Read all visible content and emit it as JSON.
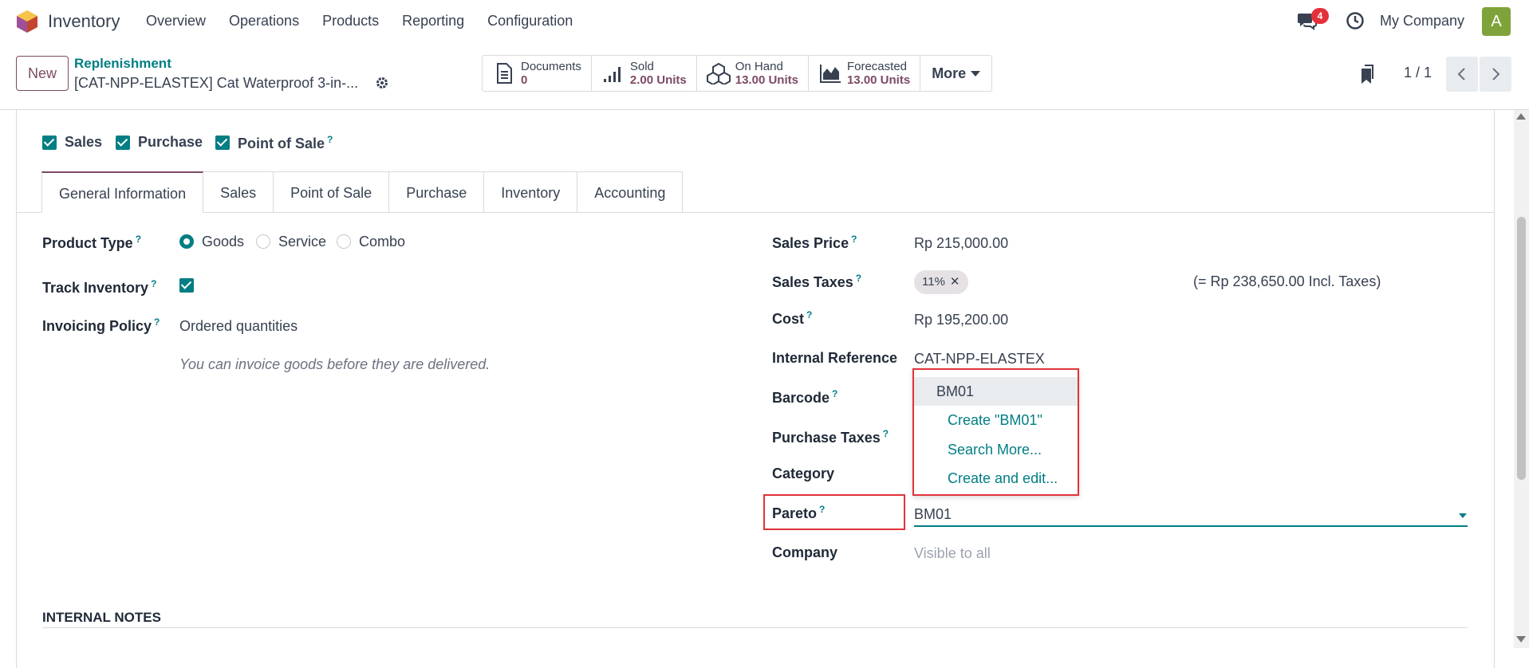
{
  "app": {
    "name": "Inventory"
  },
  "menu": [
    "Overview",
    "Operations",
    "Products",
    "Reporting",
    "Configuration"
  ],
  "systray": {
    "chat_count": "4",
    "company": "My Company",
    "avatar_letter": "A"
  },
  "control": {
    "new_label": "New",
    "breadcrumb_parent": "Replenishment",
    "breadcrumb_current": "[CAT-NPP-ELASTEX] Cat Waterproof 3-in-...",
    "pager": "1 / 1"
  },
  "smart_buttons": {
    "documents": {
      "label": "Documents",
      "value": "0"
    },
    "sold": {
      "label": "Sold",
      "value": "2.00 Units"
    },
    "on_hand": {
      "label": "On Hand",
      "value": "13.00 Units"
    },
    "forecasted": {
      "label": "Forecasted",
      "value": "13.00 Units"
    },
    "more": "More"
  },
  "flags": {
    "sales": "Sales",
    "purchase": "Purchase",
    "pos": "Point of Sale"
  },
  "tabs": [
    "General Information",
    "Sales",
    "Point of Sale",
    "Purchase",
    "Inventory",
    "Accounting"
  ],
  "left": {
    "product_type_label": "Product Type",
    "product_type_options": [
      "Goods",
      "Service",
      "Combo"
    ],
    "product_type_selected": "Goods",
    "track_inventory_label": "Track Inventory",
    "invoicing_policy_label": "Invoicing Policy",
    "invoicing_policy_value": "Ordered quantities",
    "invoicing_hint": "You can invoice goods before they are delivered."
  },
  "right": {
    "sales_price_label": "Sales Price",
    "sales_price_value": "Rp 215,000.00",
    "sales_taxes_label": "Sales Taxes",
    "sales_taxes_tag": "11%",
    "sales_taxes_incl": "(= Rp 238,650.00 Incl. Taxes)",
    "cost_label": "Cost",
    "cost_value": "Rp 195,200.00",
    "internal_ref_label": "Internal Reference",
    "internal_ref_value": "CAT-NPP-ELASTEX",
    "barcode_label": "Barcode",
    "purchase_taxes_label": "Purchase Taxes",
    "category_label": "Category",
    "pareto_label": "Pareto",
    "pareto_value": "BM01",
    "company_label": "Company",
    "company_placeholder": "Visible to all"
  },
  "dropdown": {
    "selected": "BM01",
    "create": "Create \"BM01\"",
    "search_more": "Search More...",
    "create_edit": "Create and edit..."
  },
  "notes": {
    "title": "INTERNAL NOTES"
  },
  "colors": {
    "brand": "#7c4a63",
    "accent": "#017e84",
    "highlight": "#e0333a"
  }
}
